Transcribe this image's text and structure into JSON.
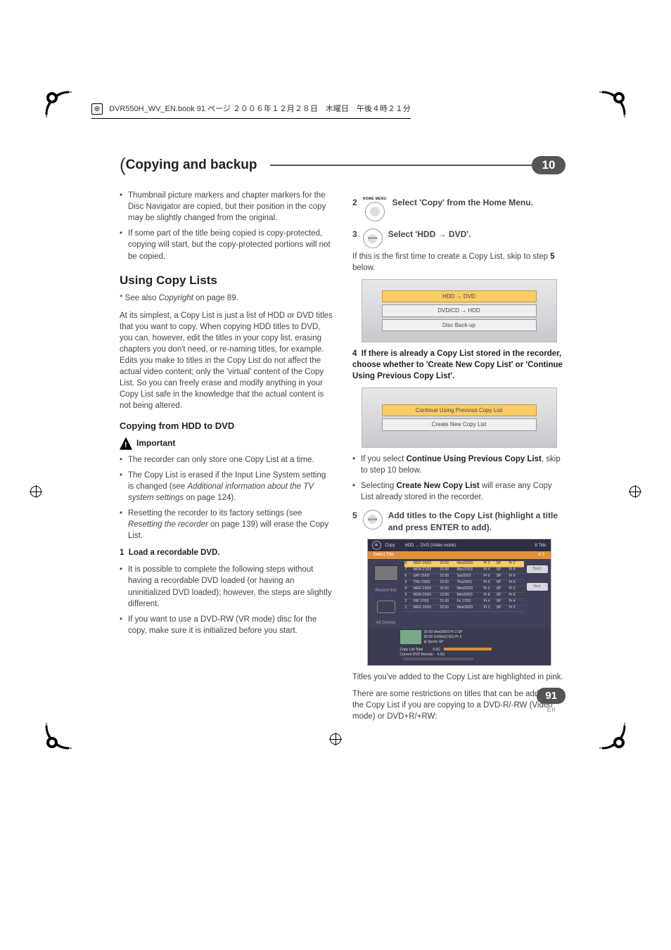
{
  "meta": {
    "header_line": "DVR550H_WV_EN.book 91 ページ ２００６年１２月２８日　木曜日　午後４時２１分"
  },
  "chapter": {
    "title": "Copying and backup",
    "number": "10"
  },
  "left_col": {
    "bullet1": "Thumbnail picture markers and chapter markers for the Disc Navigator are copied, but their position in the copy may be slightly changed from the original.",
    "bullet2": "If some part of the title being copied is copy-protected, copying will start, but the copy-protected portions will not be copied.",
    "h2": "Using Copy Lists",
    "see_also_prefix": "* See also ",
    "see_also_em": "Copyright",
    "see_also_suffix": " on page 89.",
    "para1": "At its simplest, a Copy List is just a list of HDD or DVD titles that you want to copy. When copying HDD titles to DVD, you can, however, edit the titles in your copy list, erasing chapters you don't need, or re-naming titles, for example. Edits you make to titles in the Copy List do not affect the actual video content; only the 'virtual' content of the Copy List. So you can freely erase and modify anything in your Copy List safe in the knowledge that the actual content is not being altered.",
    "h3_copying": "Copying from HDD to DVD",
    "important_label": "Important",
    "b2_1": "The recorder can only store one Copy List at a time.",
    "b2_2a": "The Copy List is erased if the Input Line System setting is changed (see ",
    "b2_2b": "Additional information about the TV system settings",
    "b2_2c": " on page 124).",
    "b2_3a": "Resetting the recorder to its factory settings (see ",
    "b2_3b": "Resetting the recorder",
    "b2_3c": " on page 139) will erase the Copy List.",
    "step1_num": "1",
    "step1_text": "Load a recordable DVD.",
    "b3_1": "It is possible to complete the following steps without having a recordable DVD loaded (or having an uninitialized DVD loaded); however, the steps are slightly different.",
    "b3_2": "If you want to use a DVD-RW (VR mode) disc for the copy, make sure it is initialized before you start."
  },
  "right_col": {
    "step2_num": "2",
    "step2_icon_top": "HOME MENU",
    "step2_text": "Select 'Copy' from the Home Menu.",
    "step3_num": "3",
    "step3_icon_center": "ENTER",
    "step3_text": "Select 'HDD → DVD'.",
    "step3_para1": "If this is the first time to create a Copy List, skip to step ",
    "step3_para1_b": "5",
    "step3_para1_end": " below.",
    "osd1_opt1": "HDD → DVD",
    "osd1_opt2": "DVD/CD → HDD",
    "osd1_opt3": "Disc Back-up",
    "step4_num": "4",
    "step4_text": "If there is already a Copy List stored in the recorder, choose whether to 'Create New Copy List' or 'Continue Using Previous Copy List'.",
    "osd2_opt1": "Continue Using Previous Copy List",
    "osd2_opt2": "Create New Copy List",
    "b4_1a": "If you select ",
    "b4_1b": "Continue Using Previous Copy List",
    "b4_1c": ", skip to step 10 below.",
    "b4_2a": "Selecting ",
    "b4_2b": "Create New Copy List",
    "b4_2c": " will erase any Copy List already stored in the recorder.",
    "step5_num": "5",
    "step5_icon_center": "ENTER",
    "step5_text": "Add titles to the Copy List (highlight a title and press ENTER to add).",
    "copy_ui": {
      "title": "Copy",
      "mode": "HDD → DVD (Video mode)",
      "right_count": "8 Title",
      "tab": "Select Title",
      "pager": "1/ 1",
      "left_recent": "Recent first",
      "left_all": "All Genres",
      "rows": [
        [
          "8",
          "WED 29/03",
          "20:00",
          "Wed29/03",
          "Pr 2",
          "SP",
          "Pr 2"
        ],
        [
          "7",
          "MON 27/03",
          "21:00",
          "Mon27/03",
          "Pr 4",
          "SP",
          "Pr 4"
        ],
        [
          "6",
          "SAT 25/03",
          "23:30",
          "Sat25/03",
          "Pr 9",
          "SP",
          "Pr 9"
        ],
        [
          "5",
          "THU 23/03",
          "22:00",
          "Thu23/03",
          "Pr 6",
          "SP",
          "Pr 6"
        ],
        [
          "4",
          "WED 22/03",
          "20:00",
          "Wed22/03",
          "Pr 2",
          "SP",
          "Pr 2"
        ],
        [
          "3",
          "MON 20/03",
          "13:00",
          "Mon20/03",
          "Pr 8",
          "SP",
          "Pr 8"
        ],
        [
          "2",
          "FRI 17/03",
          "21:00",
          "Fri 17/03",
          "Pr 4",
          "SP",
          "Pr 4"
        ],
        [
          "1",
          "WED 15/03",
          "20:00",
          "Wed15/03",
          "Pr 2",
          "SP",
          "Pr 2"
        ]
      ],
      "side_back": "Back",
      "side_next": "Next",
      "detail_line1": "20:00   Wed29/03   Pr 2   SP",
      "detail_line2": "20:00               1h00m(2.0G)               Pr 2",
      "detail_line3": "         ⊞ Sports          SP",
      "footer1": "Copy List Total",
      "footer1v": "0.0G",
      "footer2": "Current DVD Remain",
      "footer2v": "4.3G"
    },
    "after_ui1": "Titles you've added to the Copy List are highlighted in pink.",
    "after_ui2": "There are some restrictions on titles that can be added to the Copy List if you are copying to a DVD-R/-RW (Video mode) or DVD+R/+RW:"
  },
  "page_number": "91",
  "page_lang": "En"
}
